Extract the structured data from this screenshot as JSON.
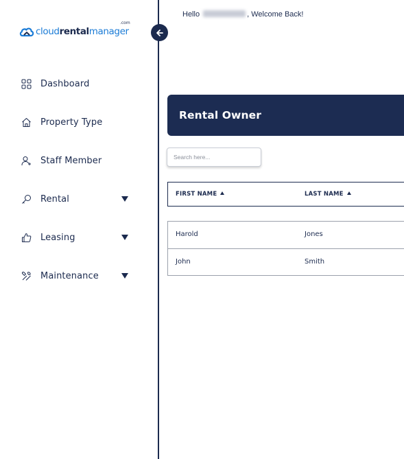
{
  "brand": {
    "part1": "cloud",
    "part2": "rental",
    "part3": "manager",
    "suffix": ".com",
    "colors": {
      "blue": "#1a7bd6",
      "navy": "#1b2a4e"
    }
  },
  "sidebar": {
    "collapse_icon": "arrow-left-icon",
    "items": [
      {
        "label": "Dashboard",
        "icon": "dashboard-grid-icon",
        "expandable": false
      },
      {
        "label": "Property Type",
        "icon": "home-icon",
        "expandable": false
      },
      {
        "label": "Staff Member",
        "icon": "user-plus-icon",
        "expandable": false
      },
      {
        "label": "Rental",
        "icon": "key-icon",
        "expandable": true
      },
      {
        "label": "Leasing",
        "icon": "thumbs-up-icon",
        "expandable": true
      },
      {
        "label": "Maintenance",
        "icon": "tools-icon",
        "expandable": true
      }
    ]
  },
  "header": {
    "greeting_prefix": "Hello",
    "greeting_suffix": ", Welcome Back!"
  },
  "page": {
    "title": "Rental Owner",
    "banner_color": "#1c2c52"
  },
  "search": {
    "placeholder": "Search here...",
    "value": ""
  },
  "table": {
    "columns": [
      {
        "label": "FIRST NAME",
        "sort": "ascending"
      },
      {
        "label": "LAST NAME",
        "sort": "ascending"
      }
    ],
    "rows": [
      [
        "Harold",
        "Jones"
      ],
      [
        "John",
        "Smith"
      ]
    ]
  }
}
